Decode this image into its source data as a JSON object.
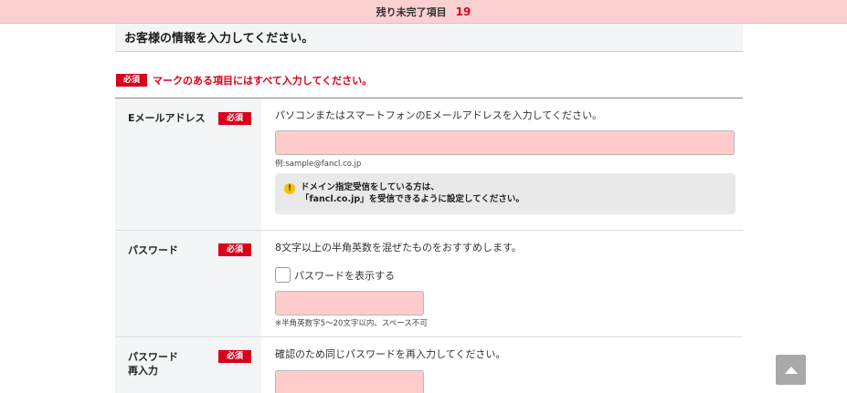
{
  "banner": {
    "label": "残り未完了項目",
    "count": "19"
  },
  "section": {
    "title": "お客様の情報を入力してください。"
  },
  "required": {
    "badge": "必須",
    "note": "マークのある項目にはすべて入力してください。"
  },
  "email": {
    "label": "Eメールアドレス",
    "hint": "パソコンまたはスマートフォンのEメールアドレスを入力してください。",
    "value": "",
    "example": "例:sample@fancl.co.jp",
    "info_line1": "ドメイン指定受信をしている方は、",
    "info_line2": "「fancl.co.jp」を受信できるように設定してください。",
    "warn_symbol": "!"
  },
  "password": {
    "label": "パスワード",
    "hint": "8文字以上の半角英数を混ぜたものをおすすめします。",
    "show_label": "パスワードを表示する",
    "value": "",
    "note": "※半角英数字5～20文字以内、スペース不可"
  },
  "password_confirm": {
    "label_line1": "パスワード",
    "label_line2": "再入力",
    "hint": "確認のため同じパスワードを再入力してください。",
    "value": ""
  },
  "colors": {
    "required_red": "#d9001b",
    "input_bg": "#ffcccc",
    "banner_bg": "#fbd0d0"
  },
  "icons": {
    "scroll_top": "triangle-up-icon",
    "warning": "exclamation-icon"
  }
}
